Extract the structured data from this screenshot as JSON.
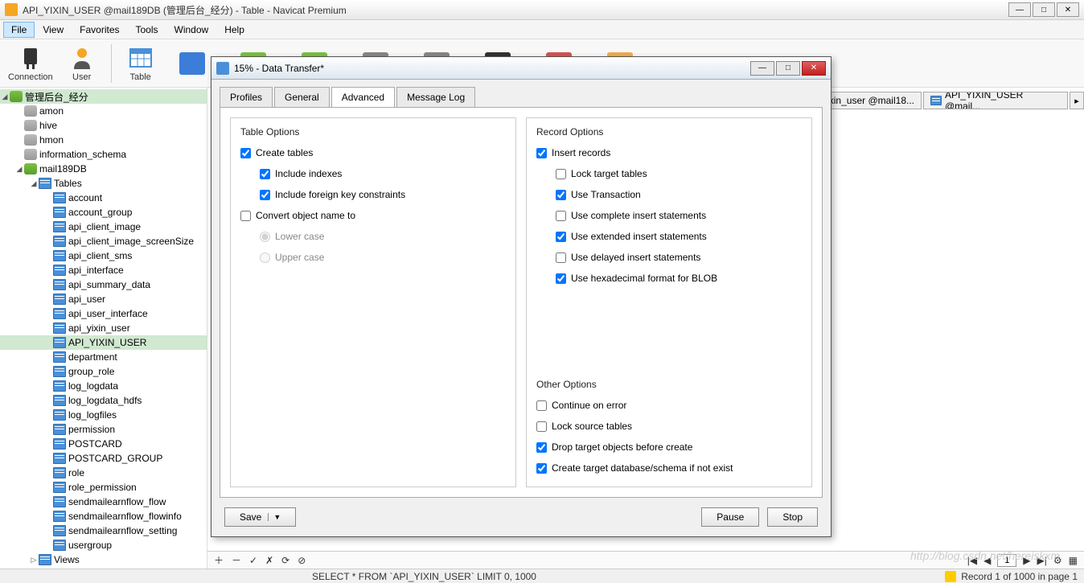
{
  "window": {
    "title": "API_YIXIN_USER @mail189DB (管理后台_经分) - Table - Navicat Premium"
  },
  "menu": {
    "file": "File",
    "view": "View",
    "favorites": "Favorites",
    "tools": "Tools",
    "window": "Window",
    "help": "Help"
  },
  "toolbar": {
    "connection": "Connection",
    "user": "User",
    "table": "Table"
  },
  "tree": {
    "root": "管理后台_经分",
    "dbs_gray": [
      "amon",
      "hive",
      "hmon",
      "information_schema"
    ],
    "db_active": "mail189DB",
    "tables_label": "Tables",
    "tables": [
      "account",
      "account_group",
      "api_client_image",
      "api_client_image_screenSize",
      "api_client_sms",
      "api_interface",
      "api_summary_data",
      "api_user",
      "api_user_interface",
      "api_yixin_user",
      "API_YIXIN_USER",
      "department",
      "group_role",
      "log_logdata",
      "log_logdata_hdfs",
      "log_logfiles",
      "permission",
      "POSTCARD",
      "POSTCARD_GROUP",
      "role",
      "role_permission",
      "sendmailearnflow_flow",
      "sendmailearnflow_flowinfo",
      "sendmailearnflow_setting",
      "usergroup"
    ],
    "views_label": "Views",
    "selected_table": "API_YIXIN_USER"
  },
  "doc_tabs": {
    "tab1": "xin_user @mail18...",
    "tab2": "API_YIXIN_USER @mail..."
  },
  "dialog": {
    "title": "15% - Data Transfer*",
    "tabs": {
      "profiles": "Profiles",
      "general": "General",
      "advanced": "Advanced",
      "message_log": "Message Log"
    },
    "table_options": {
      "title": "Table Options",
      "create_tables": "Create tables",
      "include_indexes": "Include indexes",
      "include_fk": "Include foreign key constraints",
      "convert_name": "Convert object name to",
      "lower": "Lower case",
      "upper": "Upper case"
    },
    "record_options": {
      "title": "Record Options",
      "insert_records": "Insert records",
      "lock_target": "Lock target tables",
      "use_transaction": "Use Transaction",
      "complete_insert": "Use complete insert statements",
      "extended_insert": "Use extended insert statements",
      "delayed_insert": "Use delayed insert statements",
      "hex_blob": "Use hexadecimal format for BLOB"
    },
    "other_options": {
      "title": "Other Options",
      "continue_error": "Continue on error",
      "lock_source": "Lock source tables",
      "drop_target": "Drop target objects before create",
      "create_db": "Create target database/schema if not exist"
    },
    "buttons": {
      "save": "Save",
      "pause": "Pause",
      "stop": "Stop"
    }
  },
  "status": {
    "sql": "SELECT * FROM `API_YIXIN_USER` LIMIT 0, 1000",
    "record": "Record 1 of 1000 in page 1",
    "page": "1"
  },
  "watermark": "http://blog.csdn.net/hereiskxm"
}
